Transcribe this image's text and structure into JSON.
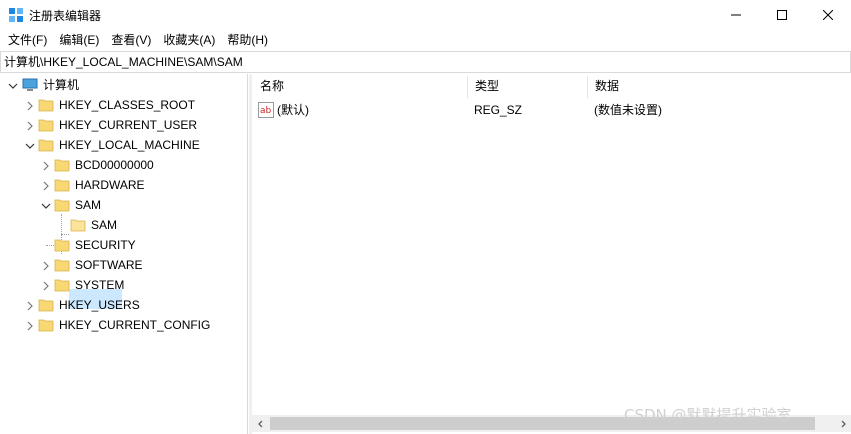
{
  "window": {
    "title": "注册表编辑器",
    "icon": "registry-editor-icon",
    "controls": {
      "minimize": "minimize-icon",
      "maximize": "maximize-icon",
      "close": "close-icon"
    }
  },
  "menu": [
    "文件(F)",
    "编辑(E)",
    "查看(V)",
    "收藏夹(A)",
    "帮助(H)"
  ],
  "address": "计算机\\HKEY_LOCAL_MACHINE\\SAM\\SAM",
  "tree": {
    "root": "计算机",
    "items": [
      {
        "label": "HKEY_CLASSES_ROOT",
        "expanded": false
      },
      {
        "label": "HKEY_CURRENT_USER",
        "expanded": false
      },
      {
        "label": "HKEY_LOCAL_MACHINE",
        "expanded": true
      },
      {
        "label": "BCD00000000",
        "expanded": false
      },
      {
        "label": "HARDWARE",
        "expanded": false
      },
      {
        "label": "SAM",
        "expanded": true
      },
      {
        "label": "SAM",
        "selected": true
      },
      {
        "label": "SECURITY"
      },
      {
        "label": "SOFTWARE",
        "expanded": false
      },
      {
        "label": "SYSTEM",
        "expanded": false
      },
      {
        "label": "HKEY_USERS",
        "expanded": false
      },
      {
        "label": "HKEY_CURRENT_CONFIG",
        "expanded": false
      }
    ]
  },
  "list": {
    "columns": [
      "名称",
      "类型",
      "数据"
    ],
    "rows": [
      {
        "name": "(默认)",
        "type": "REG_SZ",
        "data": "(数值未设置)",
        "icon": "string-value-icon"
      }
    ]
  },
  "watermark": "CSDN @默默提升实验室",
  "colors": {
    "selection": "#cce8ff",
    "folder": "#f8d775",
    "border": "#d9d9d9"
  }
}
